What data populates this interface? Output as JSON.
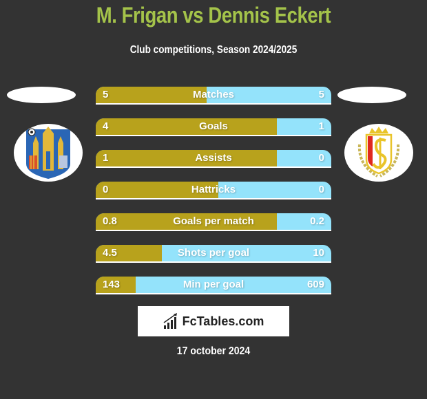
{
  "header": {
    "title": "M. Frigan vs Dennis Eckert",
    "subtitle": "Club competitions, Season 2024/2025"
  },
  "players": {
    "left": {
      "name": "M. Frigan",
      "club_logo": "westerlo-crest-icon"
    },
    "right": {
      "name": "Dennis Eckert",
      "club_logo": "standard-liege-crest-icon"
    }
  },
  "colors": {
    "left_bar": "#b8a21c",
    "right_bar": "#94e3fb",
    "title": "#a4c34a",
    "background": "#333333"
  },
  "stats": [
    {
      "label": "Matches",
      "left": "5",
      "right": "5",
      "left_share": 0.47
    },
    {
      "label": "Goals",
      "left": "4",
      "right": "1",
      "left_share": 0.77
    },
    {
      "label": "Assists",
      "left": "1",
      "right": "0",
      "left_share": 0.77
    },
    {
      "label": "Hattricks",
      "left": "0",
      "right": "0",
      "left_share": 0.52
    },
    {
      "label": "Goals per match",
      "left": "0.8",
      "right": "0.2",
      "left_share": 0.77
    },
    {
      "label": "Shots per goal",
      "left": "4.5",
      "right": "10",
      "left_share": 0.28
    },
    {
      "label": "Min per goal",
      "left": "143",
      "right": "609",
      "left_share": 0.17
    }
  ],
  "brand": {
    "name": "FcTables.com",
    "icon": "bar-chart-icon"
  },
  "footer": {
    "date": "17 october 2024"
  }
}
